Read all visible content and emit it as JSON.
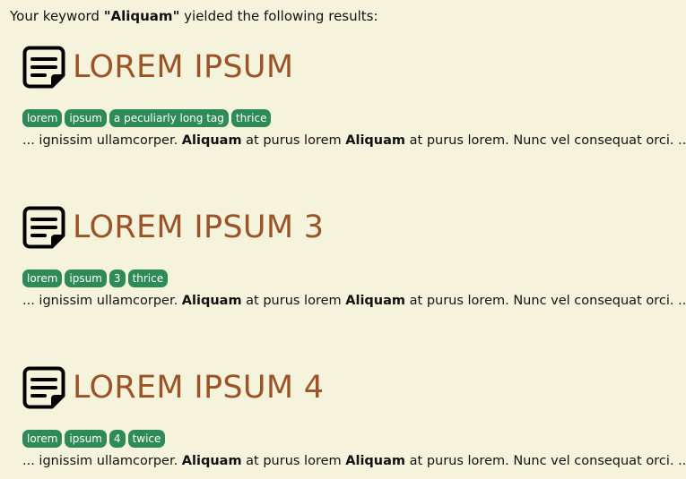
{
  "summary": {
    "prefix": "Your keyword ",
    "keyword": "\"Aliquam\"",
    "suffix": " yielded the following results:"
  },
  "results": [
    {
      "icon": "note-icon",
      "title": "LOREM IPSUM",
      "tags": [
        "lorem",
        "ipsum",
        "a peculiarly long tag",
        "thrice"
      ],
      "snippet": {
        "part1": "... ignissim ullamcorper. ",
        "match1": "Aliquam",
        "part2": " at purus lorem ",
        "match2": "Aliquam",
        "part3": " at purus lorem. Nunc vel consequat orci. ..."
      }
    },
    {
      "icon": "note-icon",
      "title": "LOREM IPSUM 3",
      "tags": [
        "lorem",
        "ipsum",
        "3",
        "thrice"
      ],
      "snippet": {
        "part1": "... ignissim ullamcorper. ",
        "match1": "Aliquam",
        "part2": " at purus lorem ",
        "match2": "Aliquam",
        "part3": " at purus lorem. Nunc vel consequat orci. ..."
      }
    },
    {
      "icon": "note-icon",
      "title": "LOREM IPSUM 4",
      "tags": [
        "lorem",
        "ipsum",
        "4",
        "twice"
      ],
      "snippet": {
        "part1": "... ignissim ullamcorper. ",
        "match1": "Aliquam",
        "part2": " at purus lorem ",
        "match2": "Aliquam",
        "part3": " at purus lorem. Nunc vel consequat orci. ..."
      }
    }
  ],
  "colors": {
    "background": "#f5f3dc",
    "title": "#9b5427",
    "tag_bg": "#2e8b57",
    "tag_text": "#ffffff"
  }
}
